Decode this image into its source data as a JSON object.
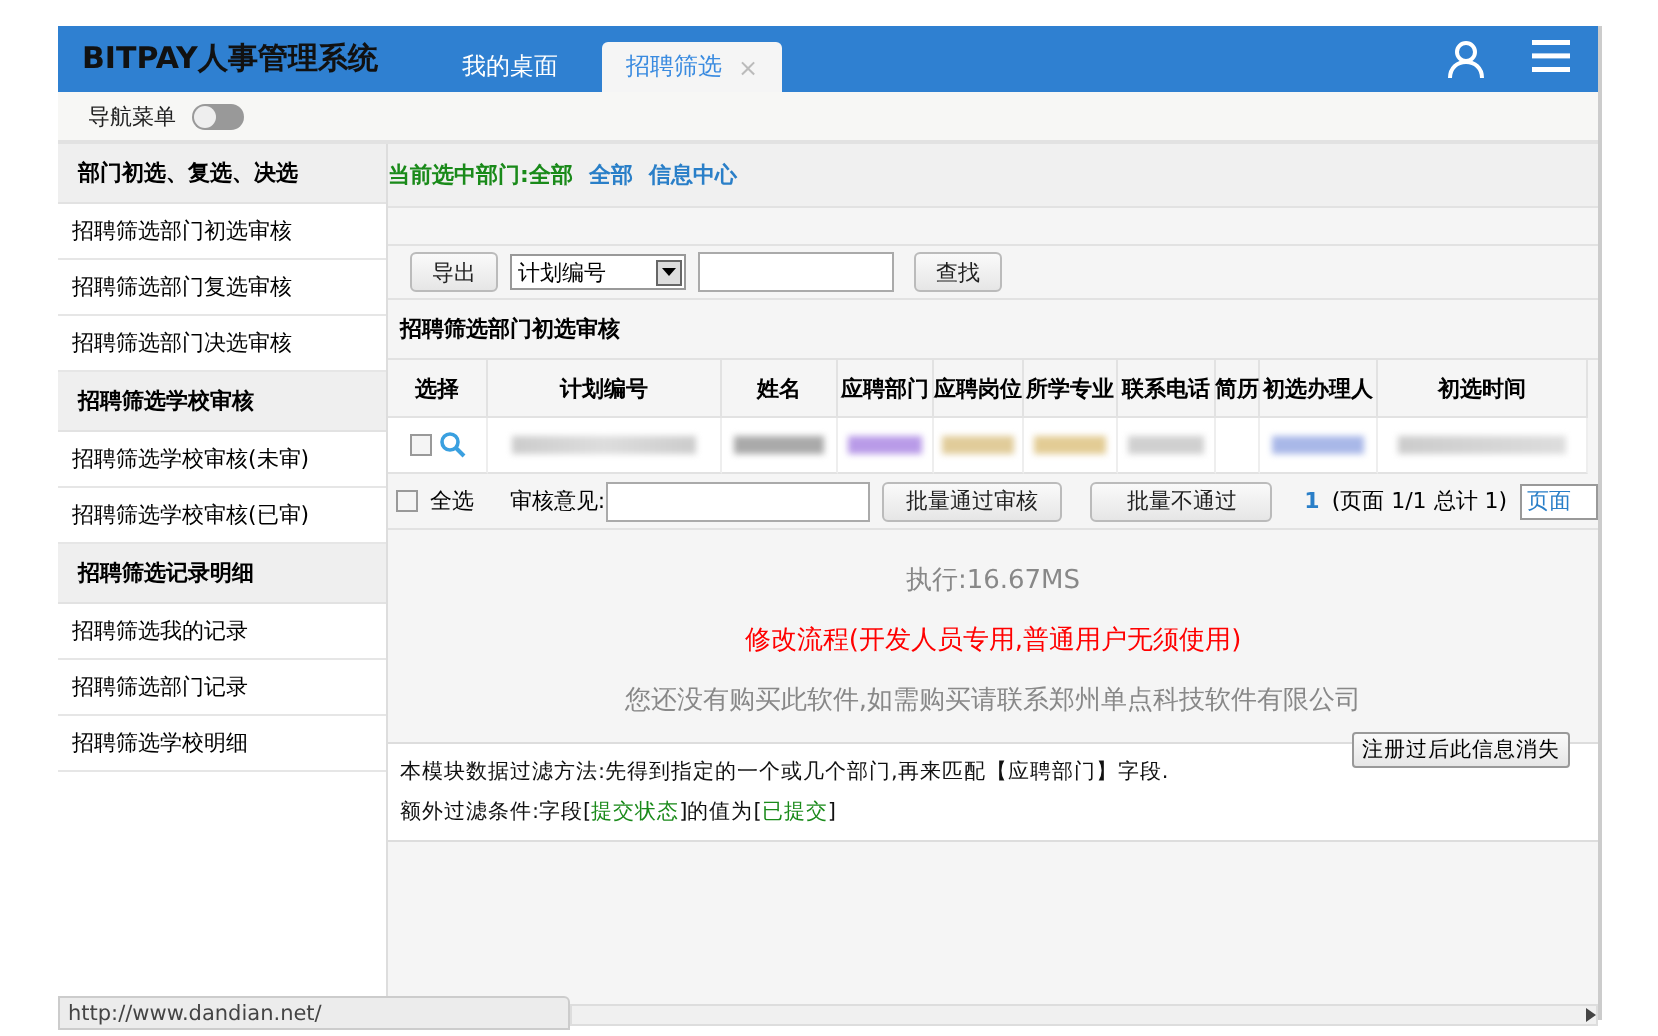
{
  "header": {
    "title": "BITPAY人事管理系统",
    "tabs": [
      {
        "label": "我的桌面",
        "selected": false
      },
      {
        "label": "招聘筛选",
        "selected": true,
        "close": "×"
      }
    ]
  },
  "nav": {
    "label": "导航菜单",
    "on": false
  },
  "sidebar": [
    {
      "title": "部门初选、复选、决选",
      "items": [
        "招聘筛选部门初选审核",
        "招聘筛选部门复选审核",
        "招聘筛选部门决选审核"
      ]
    },
    {
      "title": "招聘筛选学校审核",
      "items": [
        "招聘筛选学校审核(未审)",
        "招聘筛选学校审核(已审)"
      ]
    },
    {
      "title": "招聘筛选记录明细",
      "items": [
        "招聘筛选我的记录",
        "招聘筛选部门记录",
        "招聘筛选学校明细"
      ]
    }
  ],
  "breadcrumb": {
    "current": "当前选中部门:全部",
    "links": [
      "全部",
      "信息中心"
    ]
  },
  "toolbar": {
    "export": "导出",
    "field": "计划编号",
    "search": "查找"
  },
  "table": {
    "title": "招聘筛选部门初选审核",
    "columns": [
      "选择",
      "计划编号",
      "姓名",
      "应聘部门",
      "应聘岗位",
      "所学专业",
      "联系电话",
      "简历",
      "初选办理人",
      "初选时间"
    ],
    "rows": [
      {
        "checked": false
      }
    ]
  },
  "footer": {
    "select_all": "全选",
    "select_all_checked": false,
    "comment_label": "审核意见:",
    "approve": "批量通过审核",
    "reject": "批量不通过",
    "page_link": "1",
    "page_info": "(页面 1/1 总计 1)",
    "page_select": "页面"
  },
  "notices": [
    {
      "kind": "muted",
      "text": "执行:16.67MS"
    },
    {
      "kind": "alert",
      "text": "修改流程(开发人员专用,普通用户无须使用)"
    },
    {
      "kind": "muted",
      "text": "您还没有购买此软件,如需购买请联系郑州单点科技软件有限公司"
    }
  ],
  "info": {
    "button": "注册过后此信息消失",
    "lines": [
      [
        "本模块数据过滤方法:先得到指定的一个或几个部门,再来匹配【应聘部门】字段."
      ],
      [
        "额外过滤条件:字段[",
        "提交状态",
        "]的值为[",
        "已提交",
        "]"
      ]
    ]
  },
  "status_url": "http://www.dandian.net/"
}
